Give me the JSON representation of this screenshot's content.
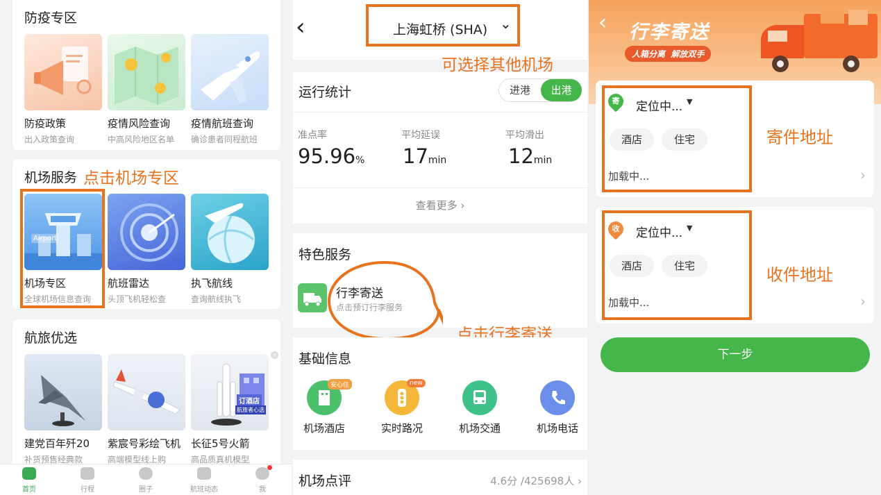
{
  "left": {
    "epidemic": {
      "title": "防疫专区",
      "tiles": [
        {
          "name": "防疫政策",
          "sub": "出入政策查询"
        },
        {
          "name": "疫情风险查询",
          "sub": "中高风险地区名单"
        },
        {
          "name": "疫情航班查询",
          "sub": "确诊患者同程航班"
        }
      ]
    },
    "airport_services": {
      "title": "机场服务",
      "annotation": "点击机场专区",
      "airport_thumb_label": "Airport",
      "tiles": [
        {
          "name": "机场专区",
          "sub": "全球机场信息查询"
        },
        {
          "name": "航班雷达",
          "sub": "头顶飞机轻松查"
        },
        {
          "name": "执飞航线",
          "sub": "查询航线执飞"
        }
      ]
    },
    "travel": {
      "title": "航旅优选",
      "hotel_badge_1": "订酒店",
      "hotel_badge_2": "航旅者心选",
      "tiles": [
        {
          "name": "建党百年歼20",
          "sub": "补货预售经典款"
        },
        {
          "name": "紫宸号彩绘飞机",
          "sub": "高端模型线上购"
        },
        {
          "name": "长征5号火箭",
          "sub": "高品质真机模型"
        }
      ]
    },
    "tabbar": [
      {
        "label": "首页",
        "icon": "home-icon"
      },
      {
        "label": "行程",
        "icon": "suitcase-icon"
      },
      {
        "label": "圈子",
        "icon": "planet-icon"
      },
      {
        "label": "航班动态",
        "icon": "plane-icon"
      },
      {
        "label": "我",
        "icon": "person-icon"
      }
    ]
  },
  "middle": {
    "header": {
      "airport": "上海虹桥 (SHA)",
      "back": "‹",
      "chevron": "⌄"
    },
    "annotation_airport": "可选择其他机场",
    "stats": {
      "title": "运行统计",
      "toggle": [
        "进港",
        "出港"
      ],
      "items": [
        {
          "label": "准点率",
          "value": "95.96",
          "unit": "%"
        },
        {
          "label": "平均延误",
          "value": "17",
          "unit": "min"
        },
        {
          "label": "平均滑出",
          "value": "12",
          "unit": "min"
        }
      ],
      "more": "查看更多 ›"
    },
    "special": {
      "title": "特色服务",
      "name": "行李寄送",
      "sub": "点击预订行李服务",
      "annotation": "点击行李寄送"
    },
    "basic": {
      "title": "基础信息",
      "items": [
        {
          "label": "机场酒店",
          "badge": "安心住",
          "color": "#4cc06a",
          "icon": "hotel-icon"
        },
        {
          "label": "实时路况",
          "badge": "new",
          "color": "#f5b73a",
          "icon": "traffic-light-icon"
        },
        {
          "label": "机场交通",
          "badge": "",
          "color": "#3fc28a",
          "icon": "bus-icon"
        },
        {
          "label": "机场电话",
          "badge": "",
          "color": "#6b8fe8",
          "icon": "phone-icon"
        }
      ]
    },
    "review": {
      "title": "机场点评",
      "score": "4.6分 /425698人 ›"
    }
  },
  "right": {
    "banner": {
      "title": "行李寄送",
      "slogan": "人箱分离  解放双手",
      "back": "‹"
    },
    "send": {
      "tag": "寄",
      "location": "定位中...",
      "pills": [
        "酒店",
        "住宅"
      ],
      "loading": "加载中...",
      "annotation": "寄件地址"
    },
    "receive": {
      "tag": "收",
      "location": "定位中...",
      "pills": [
        "酒店",
        "住宅"
      ],
      "loading": "加载中...",
      "annotation": "收件地址"
    },
    "next_button": "下一步"
  },
  "colors": {
    "accent_green": "#45b649",
    "annotation_orange": "#e8731f"
  }
}
